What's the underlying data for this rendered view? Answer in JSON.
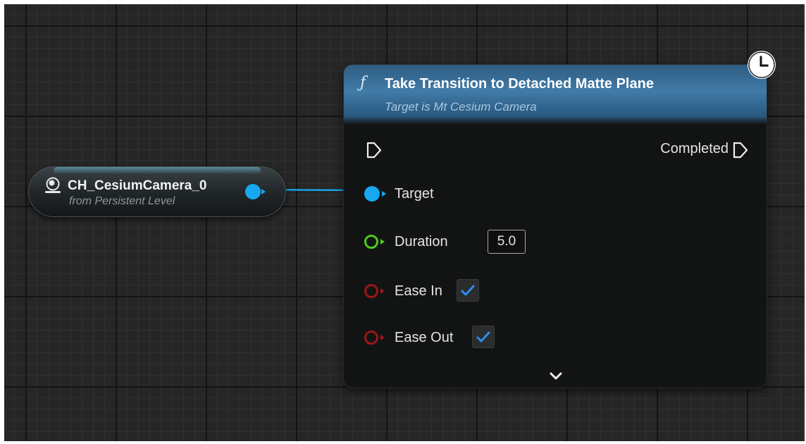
{
  "graph": {
    "reference_node": {
      "title": "CH_CesiumCamera_0",
      "subtitle": "from Persistent Level",
      "icon": "camera-actor-icon",
      "pin_color": "#17a8f0"
    },
    "function_node": {
      "icon": "function-icon",
      "icon_glyph": "ƒ",
      "title": "Take Transition to Detached Matte Plane",
      "subtitle": "Target is Mt Cesium Camera",
      "latent_icon": "clock-icon",
      "exec_out_label": "Completed",
      "pins": {
        "target": {
          "label": "Target",
          "color": "#17a8f0"
        },
        "duration": {
          "label": "Duration",
          "value": "5.0",
          "color": "#4ccc1c"
        },
        "ease_in": {
          "label": "Ease In",
          "checked": true,
          "color": "#9c1616"
        },
        "ease_out": {
          "label": "Ease Out",
          "checked": true,
          "color": "#9c1616"
        }
      },
      "expand_icon": "chevron-down-icon"
    }
  }
}
